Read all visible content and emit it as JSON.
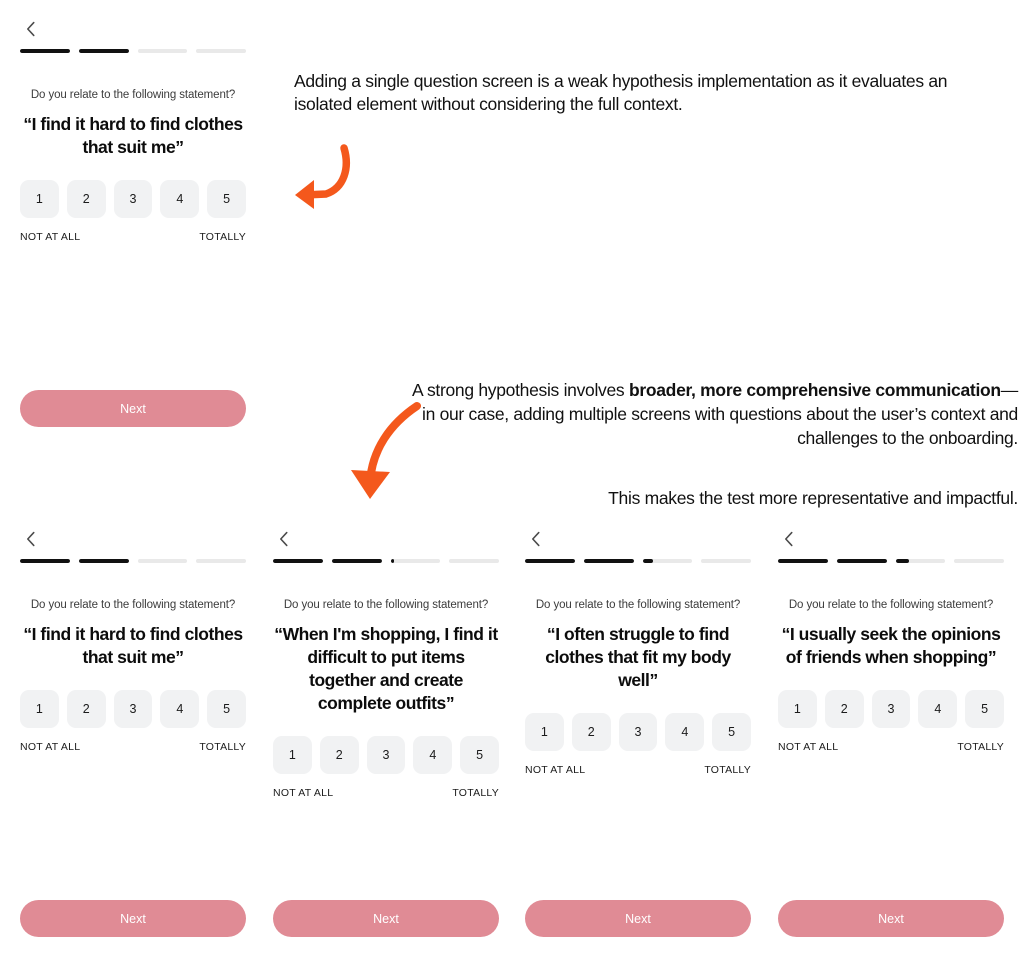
{
  "meta": {
    "accent_orange": "#F4581C",
    "button_pink": "#E08B95",
    "rating_bg": "#F1F2F3",
    "progress_filled": "#111111",
    "progress_empty": "#E9E9E9"
  },
  "common": {
    "prompt": "Do you relate to the following statement?",
    "rating_options": [
      "1",
      "2",
      "3",
      "4",
      "5"
    ],
    "scale_low_label": "NOT AT ALL",
    "scale_high_label": "TOTALLY",
    "next_label": "Next",
    "back_icon": "chevron-left-icon"
  },
  "annotations": [
    {
      "id": "weak-hypothesis-note",
      "text": "Adding a single question screen is a weak hypothesis implementation as it evaluates an isolated element without considering the full context."
    },
    {
      "id": "strong-hypothesis-note",
      "part1": "A strong hypothesis involves ",
      "bold": "broader, more comprehensive communication",
      "part2": "—in our case, adding multiple screens with questions about the user’s context and challenges to the onboarding.",
      "part3": "This makes the test more representative and impactful."
    }
  ],
  "screens": {
    "hero": {
      "name": "weak-hypothesis-single-screen",
      "statement": "“I find it hard to find clothes that suit me”",
      "progress": [
        100,
        100,
        0,
        0
      ]
    },
    "row": [
      {
        "name": "onboarding-step-1",
        "statement": "“I find it hard to find clothes that suit me”",
        "progress": [
          100,
          100,
          0,
          0
        ]
      },
      {
        "name": "onboarding-step-2",
        "statement": "“When I'm shopping, I find it difficult to put items together and create complete outfits”",
        "progress": [
          100,
          100,
          8,
          0
        ]
      },
      {
        "name": "onboarding-step-3",
        "statement": "“I often struggle to find clothes that fit my body well”",
        "progress": [
          100,
          100,
          22,
          0
        ]
      },
      {
        "name": "onboarding-step-4",
        "statement": "“I usually seek the opinions of friends when shopping”",
        "progress": [
          100,
          100,
          28,
          0
        ]
      }
    ]
  }
}
